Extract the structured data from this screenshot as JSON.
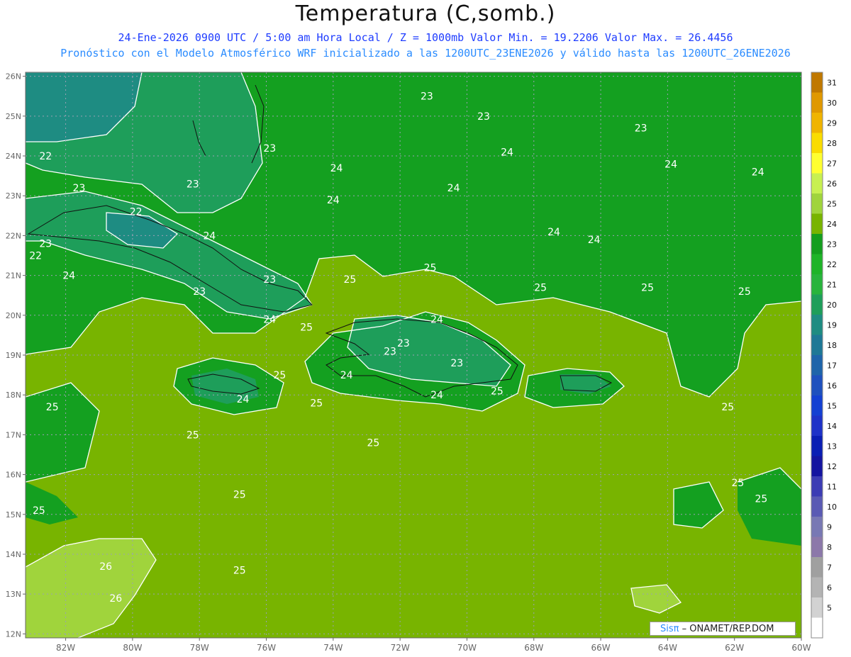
{
  "header": {
    "title": "Temperatura (C,somb.)",
    "line1": "24-Ene-2026  0900 UTC / 5:00 am Hora Local / Z = 1000mb   Valor Min. = 19.2206  Valor Max. = 26.4456",
    "line2": "Pronóstico con el Modelo Atmosférico WRF inicializado a las 1200UTC_23ENE2026 y válido hasta las  1200UTC_26ENE2026"
  },
  "map": {
    "lon_range": [
      -83.2,
      -60
    ],
    "lat_range": [
      11.9,
      26.1
    ],
    "lon_ticks": [
      "82W",
      "80W",
      "78W",
      "76W",
      "74W",
      "72W",
      "70W",
      "68W",
      "66W",
      "64W",
      "62W",
      "60W"
    ],
    "lat_ticks": [
      "26N",
      "25N",
      "24N",
      "23N",
      "22N",
      "21N",
      "20N",
      "19N",
      "18N",
      "17N",
      "16N",
      "15N",
      "14N",
      "13N",
      "12N"
    ],
    "contour_labels": [
      {
        "text": "23",
        "lon": -71.2,
        "lat": 25.5
      },
      {
        "text": "23",
        "lon": -69.5,
        "lat": 25.0
      },
      {
        "text": "23",
        "lon": -64.8,
        "lat": 24.7
      },
      {
        "text": "23",
        "lon": -75.9,
        "lat": 24.2
      },
      {
        "text": "22",
        "lon": -82.6,
        "lat": 24.0
      },
      {
        "text": "24",
        "lon": -68.8,
        "lat": 24.1
      },
      {
        "text": "24",
        "lon": -73.9,
        "lat": 23.7
      },
      {
        "text": "24",
        "lon": -63.9,
        "lat": 23.8
      },
      {
        "text": "24",
        "lon": -61.3,
        "lat": 23.6
      },
      {
        "text": "23",
        "lon": -78.2,
        "lat": 23.3
      },
      {
        "text": "23",
        "lon": -81.6,
        "lat": 23.2
      },
      {
        "text": "24",
        "lon": -70.4,
        "lat": 23.2
      },
      {
        "text": "24",
        "lon": -74.0,
        "lat": 22.9
      },
      {
        "text": "22",
        "lon": -79.9,
        "lat": 22.6
      },
      {
        "text": "24",
        "lon": -77.7,
        "lat": 22.0
      },
      {
        "text": "24",
        "lon": -67.4,
        "lat": 22.1
      },
      {
        "text": "24",
        "lon": -66.2,
        "lat": 21.9
      },
      {
        "text": "23",
        "lon": -82.6,
        "lat": 21.8
      },
      {
        "text": "22",
        "lon": -82.9,
        "lat": 21.5
      },
      {
        "text": "25",
        "lon": -71.1,
        "lat": 21.2
      },
      {
        "text": "24",
        "lon": -81.9,
        "lat": 21.0
      },
      {
        "text": "23",
        "lon": -75.9,
        "lat": 20.9
      },
      {
        "text": "25",
        "lon": -73.5,
        "lat": 20.9
      },
      {
        "text": "25",
        "lon": -67.8,
        "lat": 20.7
      },
      {
        "text": "25",
        "lon": -64.6,
        "lat": 20.7
      },
      {
        "text": "25",
        "lon": -61.7,
        "lat": 20.6
      },
      {
        "text": "23",
        "lon": -78.0,
        "lat": 20.6
      },
      {
        "text": "24",
        "lon": -75.9,
        "lat": 19.9
      },
      {
        "text": "25",
        "lon": -74.8,
        "lat": 19.7
      },
      {
        "text": "24",
        "lon": -70.9,
        "lat": 19.9
      },
      {
        "text": "23",
        "lon": -72.3,
        "lat": 19.1
      },
      {
        "text": "23",
        "lon": -71.9,
        "lat": 19.3
      },
      {
        "text": "23",
        "lon": -70.3,
        "lat": 18.8
      },
      {
        "text": "24",
        "lon": -73.6,
        "lat": 18.5
      },
      {
        "text": "25",
        "lon": -75.6,
        "lat": 18.5
      },
      {
        "text": "24",
        "lon": -76.7,
        "lat": 17.9
      },
      {
        "text": "24",
        "lon": -70.9,
        "lat": 18.0
      },
      {
        "text": "25",
        "lon": -69.1,
        "lat": 18.1
      },
      {
        "text": "25",
        "lon": -74.5,
        "lat": 17.8
      },
      {
        "text": "25",
        "lon": -82.4,
        "lat": 17.7
      },
      {
        "text": "25",
        "lon": -62.2,
        "lat": 17.7
      },
      {
        "text": "25",
        "lon": -78.2,
        "lat": 17.0
      },
      {
        "text": "25",
        "lon": -72.8,
        "lat": 16.8
      },
      {
        "text": "25",
        "lon": -61.9,
        "lat": 15.8
      },
      {
        "text": "25",
        "lon": -76.8,
        "lat": 15.5
      },
      {
        "text": "25",
        "lon": -61.2,
        "lat": 15.4
      },
      {
        "text": "25",
        "lon": -82.8,
        "lat": 15.1
      },
      {
        "text": "26",
        "lon": -80.8,
        "lat": 13.7
      },
      {
        "text": "25",
        "lon": -76.8,
        "lat": 13.6
      },
      {
        "text": "26",
        "lon": -80.5,
        "lat": 12.9
      }
    ],
    "grid": true
  },
  "colorbar": {
    "labels": [
      "31",
      "30",
      "29",
      "28",
      "27",
      "26",
      "25",
      "24",
      "23",
      "22",
      "21",
      "20",
      "19",
      "18",
      "17",
      "16",
      "15",
      "14",
      "13",
      "12",
      "11",
      "10",
      "9",
      "8",
      "7",
      "6",
      "5"
    ],
    "colors": [
      "#c07800",
      "#e09800",
      "#f0b400",
      "#fadc00",
      "#ffff30",
      "#c8f050",
      "#a0d43c",
      "#78b400",
      "#149e1e",
      "#1eb428",
      "#28b43c",
      "#1e9e5a",
      "#1e8c82",
      "#1e7896",
      "#1e64aa",
      "#1e50be",
      "#1440d2",
      "#1e32c8",
      "#0a1eb4",
      "#1414a0",
      "#3c3cb4",
      "#5a5ab4",
      "#7878b4",
      "#8c78aa",
      "#a0a0a0",
      "#b4b4b4",
      "#d2d2d2",
      "#ffffff"
    ]
  },
  "credit": {
    "sis": "Sisπ",
    "rest": "– ONAMET/REP.DOM"
  }
}
